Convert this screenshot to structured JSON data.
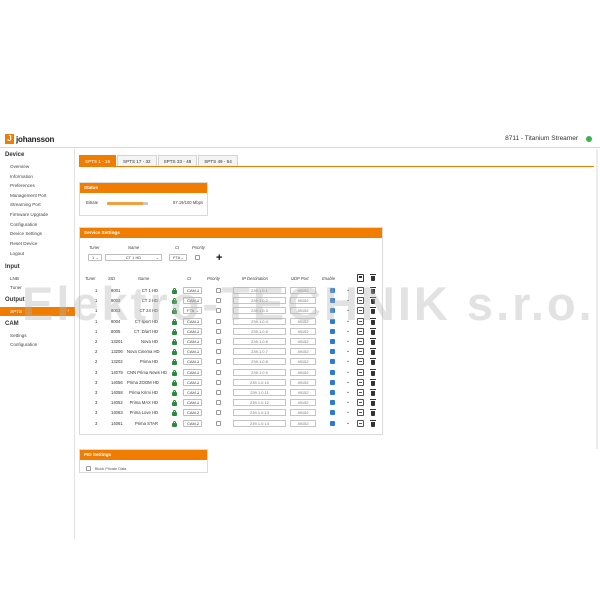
{
  "header": {
    "logo_text": "johansson",
    "logo_glyph": "J",
    "product_title": "8711 - Titanium Streamer",
    "status_color": "#3cb34a"
  },
  "sidebar": {
    "device_heading": "Device",
    "device_items": [
      "Overview",
      "Information",
      "Preferences",
      "Management Port",
      "Streaming Port",
      "Firmware Upgrade",
      "Configuration",
      "Device Settings",
      "Reset Device",
      "Logout"
    ],
    "input_heading": "Input",
    "input_items": [
      "LNB",
      "Tuner"
    ],
    "output_heading": "Output",
    "output_active": "SPTS",
    "output_arrow": "›",
    "cam_heading": "CAM",
    "cam_items": [
      "Settings",
      "Configuration"
    ]
  },
  "tabs": [
    "SPTS 1 - 16",
    "SPTS 17 - 32",
    "SPTS 33 - 48",
    "SPTS 49 - 64"
  ],
  "status": {
    "title": "Status",
    "bitrate_label": "Bitrate",
    "bitrate_value": "87.19/100 Mbps",
    "bitrate_fraction": 0.872,
    "bitrate_color": "#f0a03c"
  },
  "service": {
    "title": "Service Settings",
    "add_labels": {
      "tuner": "Tuner",
      "name": "Name",
      "ci": "CI",
      "priority": "Priority"
    },
    "add_values": {
      "tuner": "1",
      "name": "CT 1 HD",
      "ci": "FTA"
    },
    "columns": {
      "tuner": "Tuner",
      "sid": "SID",
      "name": "Name",
      "ci": "CI",
      "priority": "Priority",
      "ip": "IP Destination",
      "udp": "UDP Port",
      "enable": "Enable"
    },
    "rows": [
      {
        "tuner": "1",
        "sid": "8001",
        "name": "CT 1 HD",
        "ci": "CAM 1",
        "ip": "239.1.0.1",
        "udp": "49152"
      },
      {
        "tuner": "1",
        "sid": "8002",
        "name": "CT 2 HD",
        "ci": "CAM 1",
        "ip": "239.1.0.2",
        "udp": "49152"
      },
      {
        "tuner": "1",
        "sid": "8003",
        "name": "CT 24 HD",
        "ci": "FTA",
        "ip": "239.1.0.3",
        "udp": "49152"
      },
      {
        "tuner": "1",
        "sid": "8004",
        "name": "CT sport HD",
        "ci": "CAM 1",
        "ip": "239.1.0.4",
        "udp": "49152"
      },
      {
        "tuner": "1",
        "sid": "8005",
        "name": "CT :D/art HD",
        "ci": "CAM 1",
        "ip": "239.1.0.5",
        "udp": "49152"
      },
      {
        "tuner": "2",
        "sid": "13201",
        "name": "Nova HD",
        "ci": "CAM 1",
        "ip": "239.1.0.6",
        "udp": "49152"
      },
      {
        "tuner": "2",
        "sid": "13206",
        "name": "Nova Cinema HD",
        "ci": "CAM 1",
        "ip": "239.1.0.7",
        "udp": "49152"
      },
      {
        "tuner": "2",
        "sid": "13202",
        "name": "Prima HD",
        "ci": "CAM 1",
        "ip": "239.1.0.8",
        "udp": "49152"
      },
      {
        "tuner": "3",
        "sid": "14079",
        "name": "CNN Prima News HD",
        "ci": "CAM 1",
        "ip": "239.1.0.9",
        "udp": "49152"
      },
      {
        "tuner": "3",
        "sid": "14056",
        "name": "Prima ZOOM HD",
        "ci": "CAM 1",
        "ip": "239.1.0.10",
        "udp": "49152"
      },
      {
        "tuner": "3",
        "sid": "14058",
        "name": "Prima Krimi HD",
        "ci": "CAM 1",
        "ip": "239.1.0.11",
        "udp": "49152"
      },
      {
        "tuner": "3",
        "sid": "14052",
        "name": "Prima MAX HD",
        "ci": "CAM 1",
        "ip": "239.1.0.12",
        "udp": "49152"
      },
      {
        "tuner": "3",
        "sid": "14063",
        "name": "Prima Love HD",
        "ci": "CAM 2",
        "ip": "239.1.0.13",
        "udp": "49152"
      },
      {
        "tuner": "3",
        "sid": "14061",
        "name": "Prima STAR",
        "ci": "CAM 2",
        "ip": "239.1.0.14",
        "udp": "49152"
      }
    ]
  },
  "pid": {
    "title": "PID Settings",
    "option": "Block Private Data"
  },
  "watermark": "Elektro-TECHNIK s.r.o.",
  "icons": {
    "lock": "lock-icon",
    "save": "save-icon",
    "trash": "trash-icon",
    "edit": "edit-icon",
    "chevron": "chevron-down-icon",
    "plus": "plus-icon"
  }
}
